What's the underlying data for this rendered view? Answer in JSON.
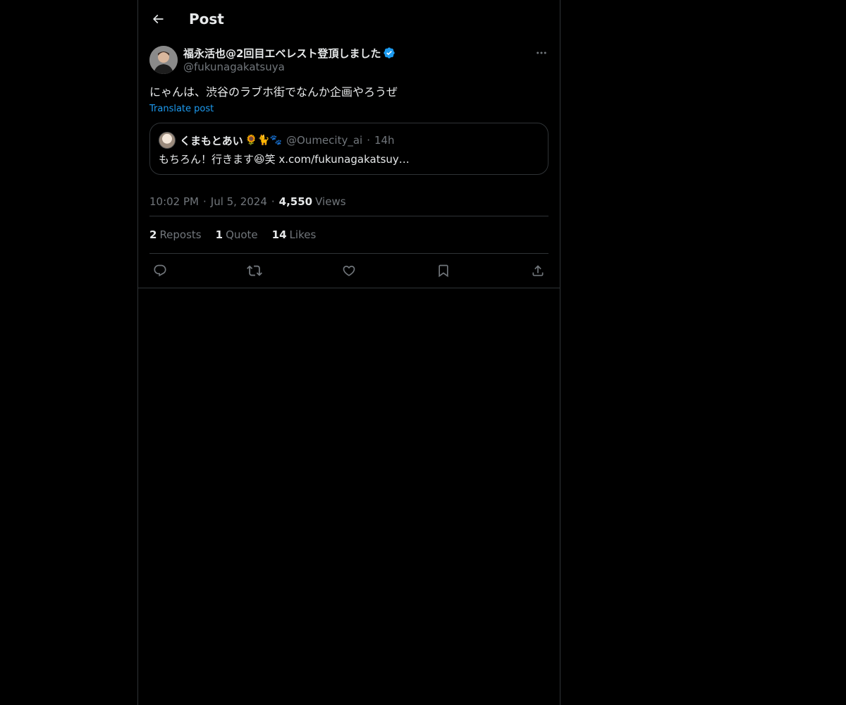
{
  "header": {
    "title": "Post"
  },
  "post": {
    "author": {
      "display_name": "福永活也@2回目エベレスト登頂しました",
      "handle": "@fukunagakatsuya",
      "verified_color": "#1d9bf0"
    },
    "text": "にゃんは、渋谷のラブホ街でなんか企画やろうぜ",
    "translate_label": "Translate post",
    "quote": {
      "display_name": "くまもとあい",
      "emojis": "🌻🐈🐾",
      "handle": "@Oumecity_ai",
      "time": "14h",
      "text": "もちろん！行きます😆笑 x.com/fukunagakatsuy…"
    },
    "timestamp": "10:02 PM",
    "date": "Jul 5, 2024",
    "views_count": "4,550",
    "views_label": "Views",
    "stats": [
      {
        "count": "2",
        "label": "Reposts"
      },
      {
        "count": "1",
        "label": "Quote"
      },
      {
        "count": "14",
        "label": "Likes"
      }
    ]
  },
  "actions": [
    "reply-icon",
    "repost-icon",
    "like-icon",
    "bookmark-icon",
    "share-icon"
  ],
  "colors": {
    "background": "#000000",
    "border": "#2f3336",
    "text": "#e7e9ea",
    "muted": "#71767b",
    "accent": "#1d9bf0"
  }
}
